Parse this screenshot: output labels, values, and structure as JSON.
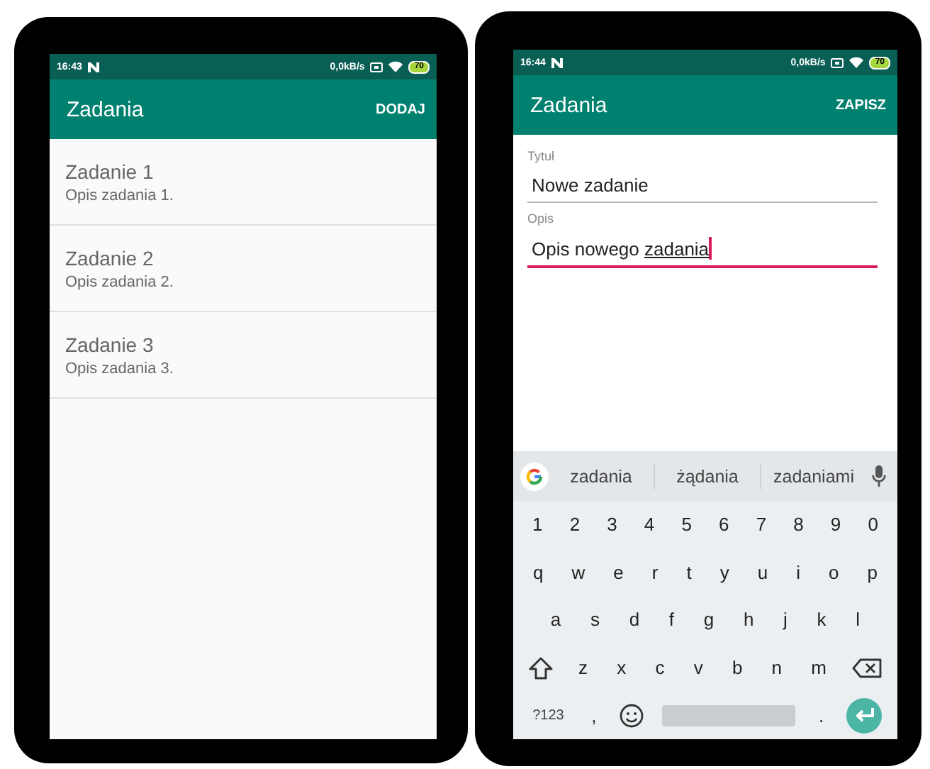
{
  "phones": [
    {
      "status_bar": {
        "time": "16:43",
        "speed": "0,0kB/s",
        "battery": "70"
      },
      "toolbar": {
        "title": "Zadania",
        "action": "DODAJ"
      },
      "tasks": [
        {
          "title": "Zadanie 1",
          "description": "Opis zadania 1."
        },
        {
          "title": "Zadanie 2",
          "description": "Opis zadania 2."
        },
        {
          "title": "Zadanie 3",
          "description": "Opis zadania 3."
        }
      ]
    },
    {
      "status_bar": {
        "time": "16:44",
        "speed": "0,0kB/s",
        "battery": "70"
      },
      "toolbar": {
        "title": "Zadania",
        "action": "ZAPISZ"
      },
      "form": [
        {
          "label": "Tytuł",
          "value": "Nowe zadanie",
          "focused": false
        },
        {
          "label": "Opis",
          "value": "Opis nowego ",
          "composing": "zadania",
          "focused": true
        }
      ],
      "keyboard": {
        "suggestions": [
          "zadania",
          "żądania",
          "zadaniami"
        ],
        "rows": [
          [
            {
              "kind": "char",
              "label": "1"
            },
            {
              "kind": "char",
              "label": "2"
            },
            {
              "kind": "char",
              "label": "3"
            },
            {
              "kind": "char",
              "label": "4"
            },
            {
              "kind": "char",
              "label": "5"
            },
            {
              "kind": "char",
              "label": "6"
            },
            {
              "kind": "char",
              "label": "7"
            },
            {
              "kind": "char",
              "label": "8"
            },
            {
              "kind": "char",
              "label": "9"
            },
            {
              "kind": "char",
              "label": "0"
            }
          ],
          [
            {
              "kind": "char",
              "label": "q"
            },
            {
              "kind": "char",
              "label": "w"
            },
            {
              "kind": "char",
              "label": "e"
            },
            {
              "kind": "char",
              "label": "r"
            },
            {
              "kind": "char",
              "label": "t"
            },
            {
              "kind": "char",
              "label": "y"
            },
            {
              "kind": "char",
              "label": "u"
            },
            {
              "kind": "char",
              "label": "i"
            },
            {
              "kind": "char",
              "label": "o"
            },
            {
              "kind": "char",
              "label": "p"
            }
          ],
          [
            {
              "kind": "char",
              "label": "a"
            },
            {
              "kind": "char",
              "label": "s"
            },
            {
              "kind": "char",
              "label": "d"
            },
            {
              "kind": "char",
              "label": "f"
            },
            {
              "kind": "char",
              "label": "g"
            },
            {
              "kind": "char",
              "label": "h"
            },
            {
              "kind": "char",
              "label": "j"
            },
            {
              "kind": "char",
              "label": "k"
            },
            {
              "kind": "char",
              "label": "l"
            }
          ],
          [
            {
              "kind": "shift"
            },
            {
              "kind": "char",
              "label": "z"
            },
            {
              "kind": "char",
              "label": "x"
            },
            {
              "kind": "char",
              "label": "c"
            },
            {
              "kind": "char",
              "label": "v"
            },
            {
              "kind": "char",
              "label": "b"
            },
            {
              "kind": "char",
              "label": "n"
            },
            {
              "kind": "char",
              "label": "m"
            },
            {
              "kind": "backspace"
            }
          ],
          [
            {
              "kind": "symbols",
              "label": "?123"
            },
            {
              "kind": "char",
              "label": ","
            },
            {
              "kind": "emoji"
            },
            {
              "kind": "space"
            },
            {
              "kind": "char",
              "label": "."
            },
            {
              "kind": "enter"
            }
          ]
        ]
      }
    }
  ]
}
